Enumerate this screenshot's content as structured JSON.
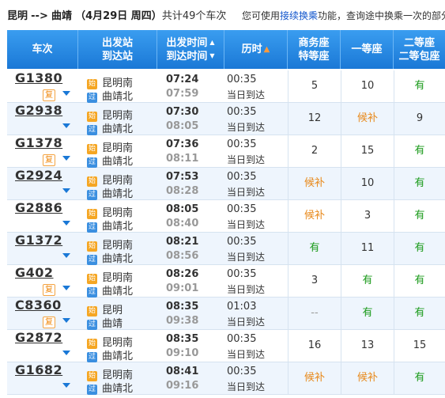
{
  "header": {
    "from": "昆明",
    "arrow": "-->",
    "to": "曲靖",
    "date": "（4月29日  周四）",
    "count_text": "共计49个车次",
    "hint_prefix": "您可使用",
    "hint_link": "接续换乘",
    "hint_suffix": "功能，查询途中换乘一次的部分"
  },
  "columns": {
    "train": "车次",
    "station_top": "出发站",
    "station_bottom": "到达站",
    "time_top": "出发时间",
    "time_bottom": "到达时间",
    "duration": "历时",
    "biz_top": "商务座",
    "biz_bottom": "特等座",
    "first": "一等座",
    "second_top": "二等座",
    "second_bottom": "二等包座"
  },
  "tags": {
    "start": "始",
    "pass": "过",
    "fu": "复"
  },
  "colors": {
    "header_blue": "#1a78d6",
    "available_green": "#1a9a1a",
    "waitlist_orange": "#e8891a"
  },
  "trains": [
    {
      "no": "G1380",
      "fu": true,
      "from": "昆明南",
      "to": "曲靖北",
      "dep": "07:24",
      "arr": "07:59",
      "dur": "00:35",
      "day": "当日到达",
      "biz": "5",
      "first": "10",
      "second": "有"
    },
    {
      "no": "G2938",
      "fu": false,
      "from": "昆明南",
      "to": "曲靖北",
      "dep": "07:30",
      "arr": "08:05",
      "dur": "00:35",
      "day": "当日到达",
      "biz": "12",
      "first": "候补",
      "second": "9"
    },
    {
      "no": "G1378",
      "fu": true,
      "from": "昆明南",
      "to": "曲靖北",
      "dep": "07:36",
      "arr": "08:11",
      "dur": "00:35",
      "day": "当日到达",
      "biz": "2",
      "first": "15",
      "second": "有"
    },
    {
      "no": "G2924",
      "fu": false,
      "from": "昆明南",
      "to": "曲靖北",
      "dep": "07:53",
      "arr": "08:28",
      "dur": "00:35",
      "day": "当日到达",
      "biz": "候补",
      "first": "10",
      "second": "有"
    },
    {
      "no": "G2886",
      "fu": false,
      "from": "昆明南",
      "to": "曲靖北",
      "dep": "08:05",
      "arr": "08:40",
      "dur": "00:35",
      "day": "当日到达",
      "biz": "候补",
      "first": "3",
      "second": "有"
    },
    {
      "no": "G1372",
      "fu": false,
      "from": "昆明南",
      "to": "曲靖北",
      "dep": "08:21",
      "arr": "08:56",
      "dur": "00:35",
      "day": "当日到达",
      "biz": "有",
      "first": "11",
      "second": "有"
    },
    {
      "no": "G402",
      "fu": true,
      "from": "昆明南",
      "to": "曲靖北",
      "dep": "08:26",
      "arr": "09:01",
      "dur": "00:35",
      "day": "当日到达",
      "biz": "3",
      "first": "有",
      "second": "有"
    },
    {
      "no": "C8360",
      "fu": true,
      "from": "昆明",
      "to": "曲靖",
      "dep": "08:35",
      "arr": "09:38",
      "dur": "01:03",
      "day": "当日到达",
      "biz": "--",
      "first": "有",
      "second": "有"
    },
    {
      "no": "G2872",
      "fu": false,
      "from": "昆明南",
      "to": "曲靖北",
      "dep": "08:35",
      "arr": "09:10",
      "dur": "00:35",
      "day": "当日到达",
      "biz": "16",
      "first": "13",
      "second": "15"
    },
    {
      "no": "G1682",
      "fu": false,
      "from": "昆明南",
      "to": "曲靖北",
      "dep": "08:41",
      "arr": "09:16",
      "dur": "00:35",
      "day": "当日到达",
      "biz": "候补",
      "first": "候补",
      "second": "有"
    }
  ]
}
